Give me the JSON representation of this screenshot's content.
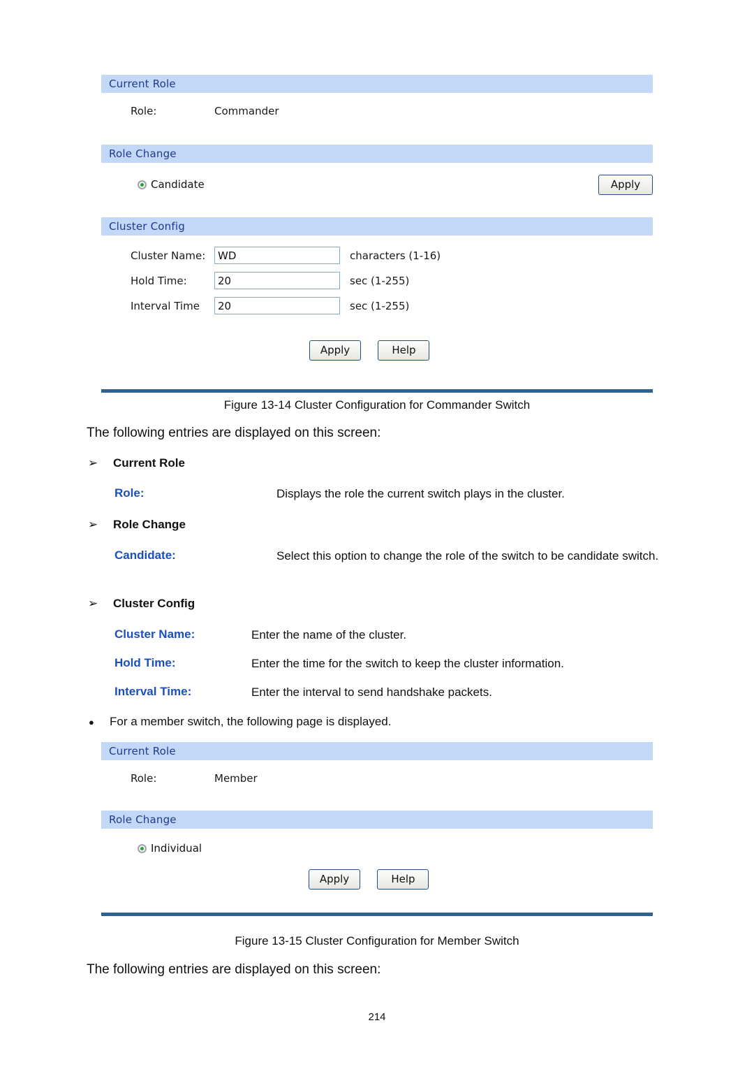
{
  "document": {
    "page_number": "214"
  },
  "figure1": {
    "caption": "Figure 13-14 Cluster Configuration for Commander Switch",
    "current_role": {
      "section_title": "Current Role",
      "role_label": "Role:",
      "role_value": "Commander"
    },
    "role_change": {
      "section_title": "Role Change",
      "option_label": "Candidate",
      "apply_label": "Apply"
    },
    "cluster_config": {
      "section_title": "Cluster Config",
      "fields": [
        {
          "label": "Cluster Name:",
          "value": "WD",
          "hint": "characters (1-16)"
        },
        {
          "label": "Hold Time:",
          "value": "20",
          "hint": "sec (1-255)"
        },
        {
          "label": "Interval Time",
          "value": "20",
          "hint": "sec (1-255)"
        }
      ],
      "apply_label": "Apply",
      "help_label": "Help"
    }
  },
  "body1": {
    "intro": "The following entries are displayed on this screen:",
    "groups": [
      {
        "heading": "Current Role",
        "entries": [
          {
            "term": "Role:",
            "desc": "Displays the role the current switch plays in the cluster."
          }
        ]
      },
      {
        "heading": "Role Change",
        "entries": [
          {
            "term": "Candidate:",
            "desc": "Select this option to change the role of the switch to be candidate switch."
          }
        ]
      },
      {
        "heading": "Cluster Config",
        "entries": [
          {
            "term": "Cluster Name:",
            "desc": "Enter the name of the cluster."
          },
          {
            "term": "Hold Time:",
            "desc": "Enter the time for the switch to keep the cluster information."
          },
          {
            "term": "Interval Time:",
            "desc": "Enter the interval to send handshake packets."
          }
        ]
      }
    ],
    "member_note": "For a member switch, the following page is displayed."
  },
  "figure2": {
    "caption": "Figure 13-15 Cluster Configuration for Member Switch",
    "current_role": {
      "section_title": "Current Role",
      "role_label": "Role:",
      "role_value": "Member"
    },
    "role_change": {
      "section_title": "Role Change",
      "option_label": "Individual",
      "apply_label": "Apply",
      "help_label": "Help"
    }
  },
  "body2": {
    "intro": "The following entries are displayed on this screen:"
  },
  "icons": {
    "arrow_bullet": "➢",
    "round_bullet": "●"
  },
  "colors": {
    "section_header_bg": "#c3d8f7",
    "section_header_text": "#1f3a8a",
    "footer_rule": "#2f6193",
    "term_blue": "#1a4fbd",
    "radio_green": "#2fa026"
  }
}
